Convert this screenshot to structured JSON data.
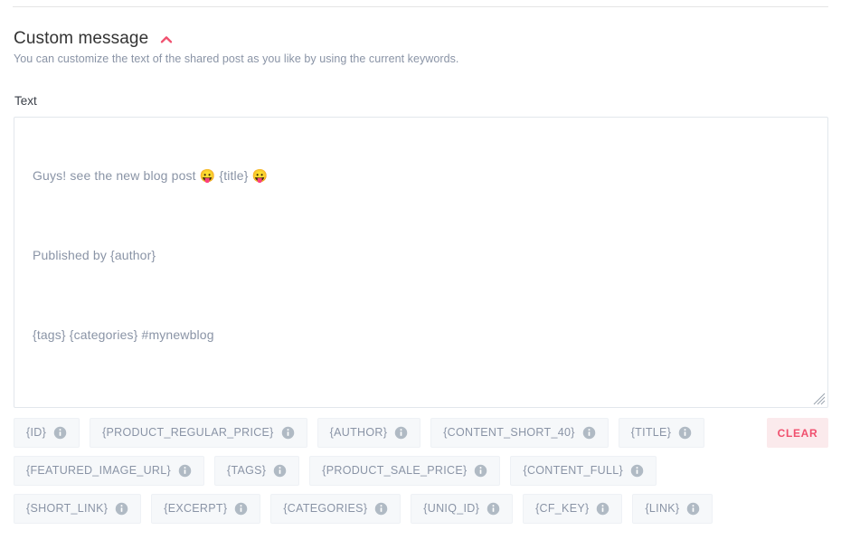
{
  "section": {
    "title": "Custom message",
    "description": "You can customize the text of the shared post as you like by using the current keywords.",
    "collapse_icon": "chevron-up-icon",
    "accent_color": "#f0506e"
  },
  "field": {
    "label": "Text",
    "value_lines": [
      "Guys! see the new blog post 😛 {title} 😛",
      "Published by {author}",
      "{tags} {categories} #mynewblog"
    ],
    "value": "Guys! see the new blog post 😛 {title} 😛\n\nPublished by {author}\n\n{tags} {categories} #mynewblog",
    "placeholder": ""
  },
  "keywords": {
    "info_icon": "info-icon",
    "rows": [
      [
        {
          "label": "{ID}"
        },
        {
          "label": "{PRODUCT_REGULAR_PRICE}"
        },
        {
          "label": "{AUTHOR}"
        },
        {
          "label": "{CONTENT_SHORT_40}"
        },
        {
          "label": "{TITLE}"
        }
      ],
      [
        {
          "label": "{FEATURED_IMAGE_URL}"
        },
        {
          "label": "{TAGS}"
        },
        {
          "label": "{PRODUCT_SALE_PRICE}"
        },
        {
          "label": "{CONTENT_FULL}"
        }
      ],
      [
        {
          "label": "{SHORT_LINK}"
        },
        {
          "label": "{EXCERPT}"
        },
        {
          "label": "{CATEGORIES}"
        },
        {
          "label": "{UNIQ_ID}"
        },
        {
          "label": "{CF_KEY}"
        },
        {
          "label": "{LINK}"
        }
      ]
    ],
    "clear_label": "CLEAR",
    "clear_color": "#f0506e",
    "clear_bg": "#fbeaec",
    "chip_bg": "#f6f8fa",
    "chip_text_color": "#8a94a6"
  }
}
